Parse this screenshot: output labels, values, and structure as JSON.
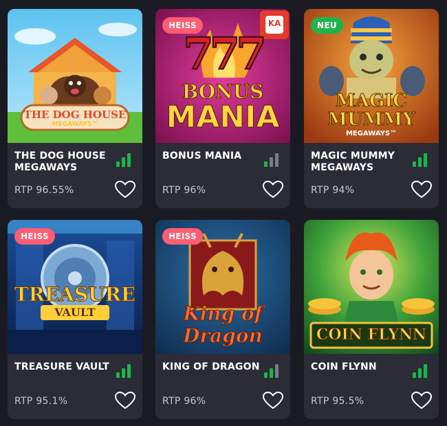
{
  "colors": {
    "card_bg": "#2b2c36",
    "page_bg": "#1a1b22",
    "badge_hot": "#ff5d72",
    "badge_new": "#1fb44b",
    "signal_on": "#1fb44b",
    "signal_off": "#7a7b86"
  },
  "games": [
    {
      "title": "THE DOG HOUSE MEGAWAYS",
      "rtp": "RTP 96.55%",
      "badge": "",
      "volatility_level": 3,
      "art_text": [
        "THE DOG HOUSE",
        "MEGAWAYS™"
      ],
      "icons": [
        "signal-bars-icon",
        "heart-icon"
      ]
    },
    {
      "title": "BONUS MANIA",
      "rtp": "RTP 96%",
      "badge": "HEISS",
      "volatility_level": 1,
      "art_text": [
        "777",
        "BONUS",
        "MANIA",
        "KA"
      ],
      "icons": [
        "signal-bars-icon",
        "heart-icon"
      ]
    },
    {
      "title": "MAGIC MUMMY MEGAWAYS",
      "rtp": "RTP 94%",
      "badge": "NEU",
      "volatility_level": 3,
      "art_text": [
        "MAGIC",
        "MUMMY",
        "MEGAWAYS™"
      ],
      "icons": [
        "signal-bars-icon",
        "heart-icon"
      ]
    },
    {
      "title": "TREASURE VAULT",
      "rtp": "RTP 95.1%",
      "badge": "HEISS",
      "volatility_level": 3,
      "art_text": [
        "TREASURE",
        "VAULT"
      ],
      "icons": [
        "signal-bars-icon",
        "heart-icon"
      ]
    },
    {
      "title": "KING OF DRAGON",
      "rtp": "RTP 96%",
      "badge": "HEISS",
      "volatility_level": 2,
      "art_text": [
        "King of",
        "Dragon"
      ],
      "icons": [
        "signal-bars-icon",
        "heart-icon"
      ]
    },
    {
      "title": "COIN FLYNN",
      "rtp": "RTP 95.5%",
      "badge": "",
      "volatility_level": 3,
      "art_text": [
        "COIN FLYNN"
      ],
      "icons": [
        "signal-bars-icon",
        "heart-icon"
      ]
    }
  ]
}
